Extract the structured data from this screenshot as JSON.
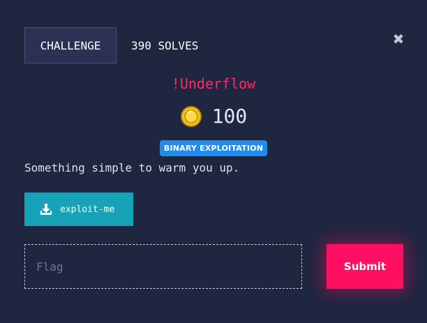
{
  "tabs": {
    "challenge_label": "CHALLENGE",
    "solves_label": "390 SOLVES"
  },
  "close": {
    "glyph": "✖",
    "icon": "close-icon"
  },
  "challenge": {
    "name": "!Underflow",
    "points": "100",
    "category": "BINARY EXPLOITATION",
    "description": "Something simple to warm you up."
  },
  "download": {
    "label": "exploit-me",
    "icon": "download-icon"
  },
  "flag": {
    "placeholder": "Flag",
    "value": ""
  },
  "submit": {
    "label": "Submit"
  },
  "colors": {
    "background": "#1f2640",
    "title": "#ff2a6d",
    "badge": "#1e8cf0",
    "download": "#17a2b8",
    "submit": "#ff0f62"
  }
}
